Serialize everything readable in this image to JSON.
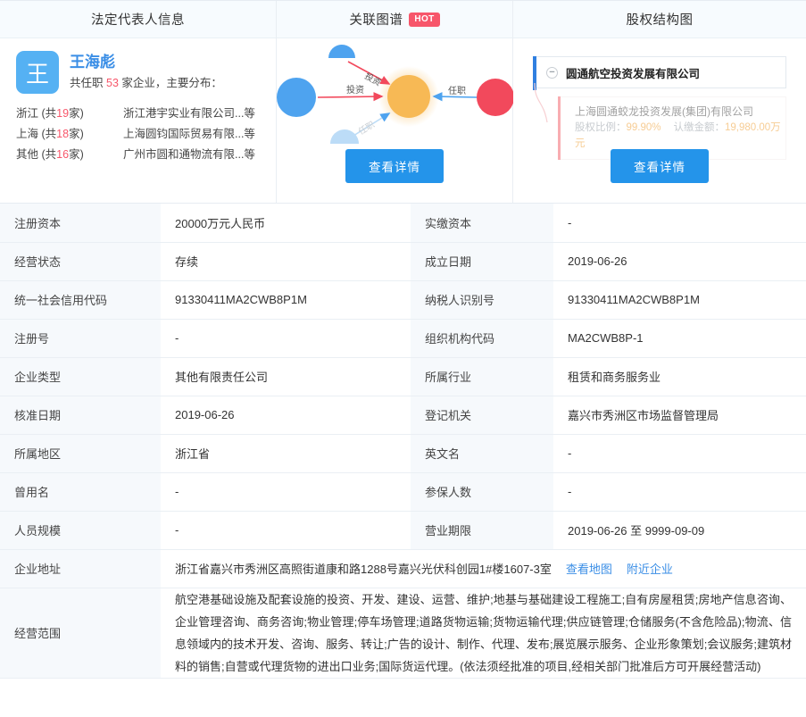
{
  "panels": {
    "legal_rep": {
      "title": "法定代表人信息",
      "avatar_letter": "王",
      "name": "王海彪",
      "sub_prefix": "共任职",
      "sub_count": "53",
      "sub_suffix": "家企业，主要分布：",
      "distribution": [
        {
          "region": "浙江",
          "prefix": "(共",
          "count": "19",
          "suffix": "家)",
          "company": "浙江港宇实业有限公司...等"
        },
        {
          "region": "上海",
          "prefix": "(共",
          "count": "18",
          "suffix": "家)",
          "company": "上海圆钧国际贸易有限...等"
        },
        {
          "region": "其他",
          "prefix": "(共",
          "count": "16",
          "suffix": "家)",
          "company": "广州市圆和通物流有限...等"
        }
      ]
    },
    "relation_graph": {
      "title": "关联图谱",
      "badge": "HOT",
      "edge_labels": {
        "invest_top": "投资",
        "invest_left": "投资",
        "position_right": "任职",
        "position_bottom": "任职"
      },
      "button": "查看详情",
      "colors": {
        "center": "#f7b955",
        "blue": "#4ea3ef",
        "red": "#f2495c",
        "invest_edge": "#f2495c",
        "position_edge": "#4ea3ef"
      }
    },
    "equity": {
      "title": "股权结构图",
      "root": "圆通航空投资发展有限公司",
      "toggle": "−",
      "child": {
        "name": "上海圆通蛟龙投资发展(集团)有限公司",
        "ratio_label": "股权比例：",
        "ratio_value": "99.90%",
        "amount_label": "认缴金额：",
        "amount_value": "19,980.00万元"
      },
      "button": "查看详情"
    }
  },
  "info_rows": [
    {
      "l1": "注册资本",
      "v1": "20000万元人民币",
      "l2": "实缴资本",
      "v2": "-"
    },
    {
      "l1": "经营状态",
      "v1": "存续",
      "l2": "成立日期",
      "v2": "2019-06-26"
    },
    {
      "l1": "统一社会信用代码",
      "v1": "91330411MA2CWB8P1M",
      "l2": "纳税人识别号",
      "v2": "91330411MA2CWB8P1M"
    },
    {
      "l1": "注册号",
      "v1": "-",
      "l2": "组织机构代码",
      "v2": "MA2CWB8P-1"
    },
    {
      "l1": "企业类型",
      "v1": "其他有限责任公司",
      "l2": "所属行业",
      "v2": "租赁和商务服务业"
    },
    {
      "l1": "核准日期",
      "v1": "2019-06-26",
      "l2": "登记机关",
      "v2": "嘉兴市秀洲区市场监督管理局"
    },
    {
      "l1": "所属地区",
      "v1": "浙江省",
      "l2": "英文名",
      "v2": "-"
    },
    {
      "l1": "曾用名",
      "v1": "-",
      "l2": "参保人数",
      "v2": "-"
    },
    {
      "l1": "人员规模",
      "v1": "-",
      "l2": "营业期限",
      "v2": "2019-06-26 至 9999-09-09"
    }
  ],
  "address_row": {
    "label": "企业地址",
    "value": "浙江省嘉兴市秀洲区高照街道康和路1288号嘉兴光伏科创园1#楼1607-3室",
    "link_map": "查看地图",
    "link_nearby": "附近企业"
  },
  "scope_row": {
    "label": "经营范围",
    "value": "航空港基础设施及配套设施的投资、开发、建设、运营、维护;地基与基础建设工程施工;自有房屋租赁;房地产信息咨询、企业管理咨询、商务咨询;物业管理;停车场管理;道路货物运输;货物运输代理;供应链管理;仓储服务(不含危险品);物流、信息领域内的技术开发、咨询、服务、转让;广告的设计、制作、代理、发布;展览展示服务、企业形象策划;会议服务;建筑材料的销售;自营或代理货物的进出口业务;国际货运代理。(依法须经批准的项目,经相关部门批准后方可开展经营活动)"
  }
}
